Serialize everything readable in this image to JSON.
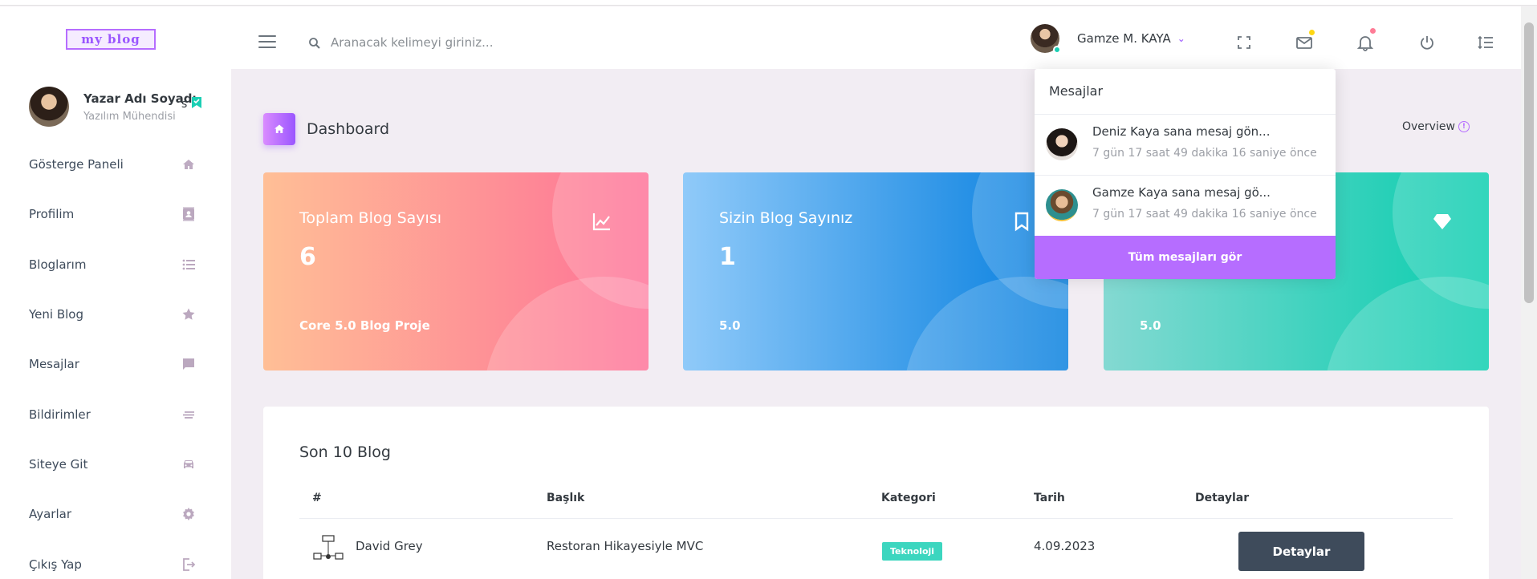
{
  "brand": {
    "logo_text": "my blog"
  },
  "topbar": {
    "search_placeholder": "Aranacak kelimeyi giriniz...",
    "user_name": "Gamze M. KAYA",
    "icons": [
      "menu-icon",
      "search-icon",
      "fullscreen-icon",
      "mail-icon",
      "bell-icon",
      "power-icon",
      "format-line-spacing-icon"
    ],
    "colors": {
      "mail_dot": "#fed713",
      "bell_dot": "#fe7c96",
      "online": "#1bcfb4"
    }
  },
  "sidebar": {
    "profile": {
      "name": "Yazar Adı Soyadı",
      "role": "Yazılım Mühendisi",
      "extra": "s"
    },
    "items": [
      {
        "label": "Gösterge Paneli",
        "icon": "home-icon"
      },
      {
        "label": "Profilim",
        "icon": "contacts-icon"
      },
      {
        "label": "Bloglarım",
        "icon": "format-list-bulleted-icon"
      },
      {
        "label": "Yeni Blog",
        "icon": "star-icon"
      },
      {
        "label": "Mesajlar",
        "icon": "message-icon"
      },
      {
        "label": "Bildirimler",
        "icon": "notes-icon"
      },
      {
        "label": "Siteye Git",
        "icon": "car-icon"
      },
      {
        "label": "Ayarlar",
        "icon": "gear-icon"
      },
      {
        "label": "Çıkış Yap",
        "icon": "logout-icon"
      }
    ]
  },
  "page": {
    "title": "Dashboard",
    "overview": "Overview"
  },
  "cards": [
    {
      "title": "Toplam Blog Sayısı",
      "value": "6",
      "foot": "Core 5.0 Blog Proje",
      "icon": "chart-line-icon"
    },
    {
      "title": "Sizin Blog Sayınız",
      "value": "1",
      "foot": "5.0",
      "icon": "bookmark-icon"
    },
    {
      "title": "",
      "value": "",
      "foot": "5.0",
      "icon": "diamond-icon"
    }
  ],
  "table": {
    "title": "Son 10 Blog",
    "headers": [
      "#",
      "Başlık",
      "Kategori",
      "Tarih",
      "Detaylar"
    ],
    "rows": [
      {
        "author": "David Grey",
        "title": "Restoran Hikayesiyle MVC",
        "category": "Teknoloji",
        "date": "4.09.2023",
        "button": "Detaylar"
      }
    ]
  },
  "messages_dropdown": {
    "header": "Mesajlar",
    "items": [
      {
        "title": "Deniz Kaya sana mesaj gön...",
        "time": "7 gün 17 saat 49 dakika 16 saniye önce"
      },
      {
        "title": "Gamze Kaya sana mesaj gö...",
        "time": "7 gün 17 saat 49 dakika 16 saniye önce"
      }
    ],
    "see_all": "Tüm mesajları gör",
    "accent": "#b66dff"
  }
}
